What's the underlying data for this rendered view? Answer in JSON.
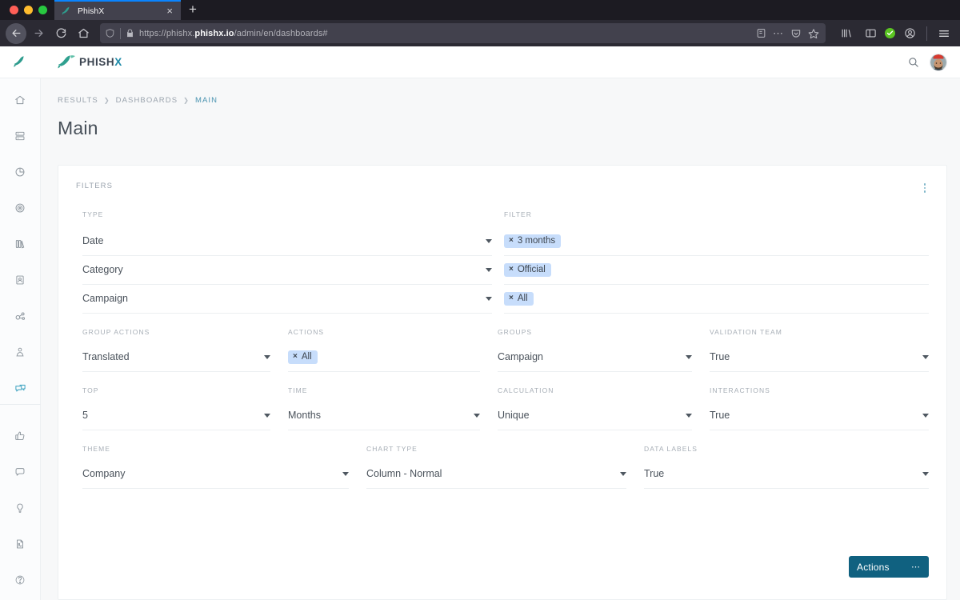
{
  "browser": {
    "tab": {
      "title": "PhishX",
      "favicon": "phishx-fish-icon",
      "close_label": "×"
    },
    "new_tab_label": "+",
    "url": {
      "scheme": "https://phishx.",
      "host": "phishx.io",
      "path": "/admin/en/dashboards#"
    },
    "icons": {
      "back": "back-arrow-icon",
      "forward": "forward-arrow-icon",
      "reload": "reload-icon",
      "home": "home-icon",
      "shield": "shield-icon",
      "lock": "lock-icon",
      "reader": "reader-view-icon",
      "more": "page-actions-icon",
      "pocket": "pocket-icon",
      "bookmark": "bookmark-star-icon",
      "library": "library-icon",
      "sidebar": "sidebar-icon",
      "sync": "sync-check-icon",
      "account": "account-icon",
      "menu": "hamburger-menu-icon"
    }
  },
  "app": {
    "brand": {
      "name_main": "PHISH",
      "name_accent": "X"
    },
    "header": {
      "search_icon": "search-icon",
      "avatar": "user-avatar"
    },
    "sidebar": {
      "items": [
        {
          "name": "home",
          "icon": "home-icon",
          "active": false
        },
        {
          "name": "database",
          "icon": "server-icon",
          "active": false
        },
        {
          "name": "reports",
          "icon": "pie-chart-icon",
          "active": false
        },
        {
          "name": "targets",
          "icon": "target-icon",
          "active": false
        },
        {
          "name": "library",
          "icon": "books-icon",
          "active": false
        },
        {
          "name": "contacts",
          "icon": "contact-card-icon",
          "active": false
        },
        {
          "name": "integrations",
          "icon": "share-network-icon",
          "active": false
        },
        {
          "name": "users",
          "icon": "person-icon",
          "active": false
        },
        {
          "name": "messages",
          "icon": "chat-bubbles-icon",
          "active": true
        },
        {
          "name": "feedback",
          "icon": "thumbs-up-icon",
          "active": false
        },
        {
          "name": "comments",
          "icon": "comment-icon",
          "active": false
        },
        {
          "name": "ideas",
          "icon": "lightbulb-icon",
          "active": false
        },
        {
          "name": "documents",
          "icon": "document-icon",
          "active": false
        },
        {
          "name": "help",
          "icon": "question-mark-icon",
          "active": false
        }
      ]
    },
    "breadcrumb": {
      "items": [
        "RESULTS",
        "DASHBOARDS",
        "MAIN"
      ],
      "separator": "❯"
    },
    "page_title": "Main",
    "filters_card": {
      "title": "FILTERS",
      "menu_icon": "kebab-menu-icon",
      "type_label": "TYPE",
      "filter_label": "FILTER",
      "type_rows": [
        {
          "type": "Date",
          "chip": "3 months"
        },
        {
          "type": "Category",
          "chip": "Official"
        },
        {
          "type": "Campaign",
          "chip": "All"
        }
      ],
      "chip_remove": "×",
      "fields": [
        {
          "label": "GROUP ACTIONS",
          "value": "Translated",
          "kind": "select"
        },
        {
          "label": "ACTIONS",
          "value": "All",
          "kind": "chip"
        },
        {
          "label": "GROUPS",
          "value": "Campaign",
          "kind": "select"
        },
        {
          "label": "VALIDATION TEAM",
          "value": "True",
          "kind": "select"
        },
        {
          "label": "TOP",
          "value": "5",
          "kind": "select"
        },
        {
          "label": "TIME",
          "value": "Months",
          "kind": "select"
        },
        {
          "label": "CALCULATION",
          "value": "Unique",
          "kind": "select"
        },
        {
          "label": "INTERACTIONS",
          "value": "True",
          "kind": "select"
        },
        {
          "label": "THEME",
          "value": "Company",
          "kind": "select"
        },
        {
          "label": "CHART TYPE",
          "value": "Column - Normal",
          "kind": "select"
        },
        {
          "label": "DATA LABELS",
          "value": "True",
          "kind": "select"
        }
      ],
      "actions_button": {
        "label": "Actions",
        "dots": "⋯"
      }
    },
    "colors": {
      "accent": "#106180",
      "brand_teal": "#1e8aa8",
      "chip_bg": "#c7ddfb",
      "breadcrumb_active": "#4a93b0"
    }
  }
}
